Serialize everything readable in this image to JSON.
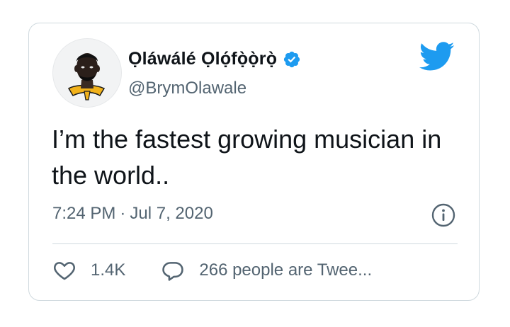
{
  "author": {
    "display_name": "Ọláwálé Ọlọ́fọ̀ọ̀rọ̀",
    "handle": "@BrymOlawale",
    "verified": true,
    "avatar": "avatar-illustration"
  },
  "tweet": {
    "text": "I’m the fastest growing musician in the world..",
    "time": "7:24 PM",
    "separator": "·",
    "date": "Jul 7, 2020"
  },
  "actions": {
    "likes": "1.4K",
    "replies_label": "266 people are Twee..."
  },
  "icons": {
    "brand": "twitter-bird-icon",
    "verified": "verified-badge-icon",
    "info": "info-icon",
    "like": "heart-icon",
    "reply": "speech-bubble-icon"
  },
  "colors": {
    "brand_blue": "#1d9bf0",
    "text": "#0f1419",
    "secondary_text": "#536471",
    "border": "#cfd9de"
  }
}
